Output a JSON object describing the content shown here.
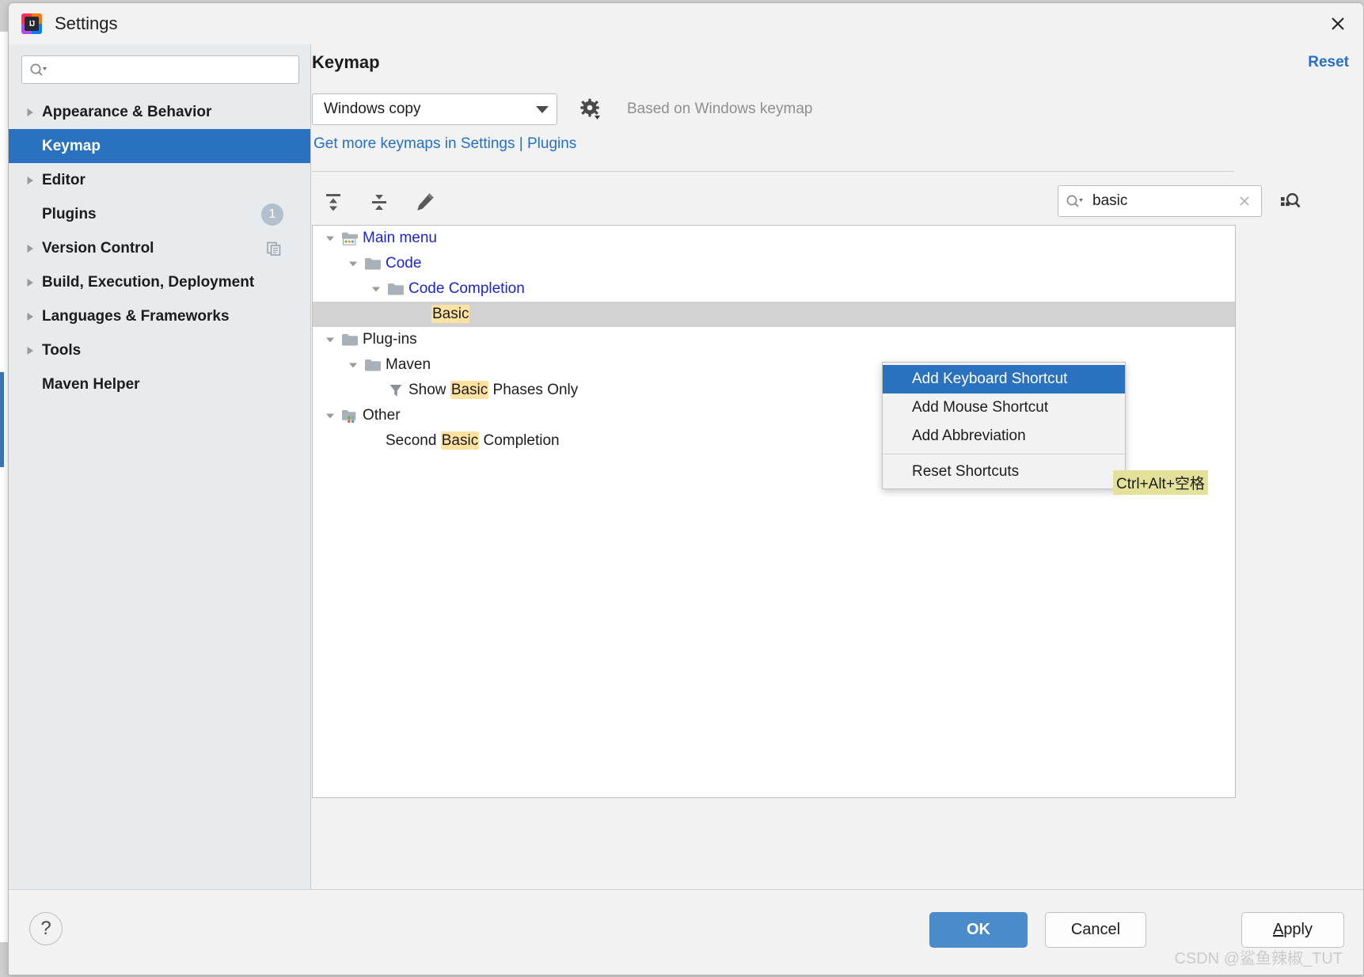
{
  "window": {
    "title": "Settings",
    "app_icon": "intellij-idea-logo",
    "close_icon": "close-icon"
  },
  "sidebar": {
    "search": {
      "value": "",
      "placeholder": "",
      "icon": "search-icon"
    },
    "items": [
      {
        "label": "Appearance & Behavior",
        "expandable": true,
        "selected": false,
        "badge": null,
        "trailing_icon": null
      },
      {
        "label": "Keymap",
        "expandable": false,
        "selected": true,
        "badge": null,
        "trailing_icon": null
      },
      {
        "label": "Editor",
        "expandable": true,
        "selected": false,
        "badge": null,
        "trailing_icon": null
      },
      {
        "label": "Plugins",
        "expandable": false,
        "selected": false,
        "badge": "1",
        "trailing_icon": null
      },
      {
        "label": "Version Control",
        "expandable": true,
        "selected": false,
        "badge": null,
        "trailing_icon": "copy-icon"
      },
      {
        "label": "Build, Execution, Deployment",
        "expandable": true,
        "selected": false,
        "badge": null,
        "trailing_icon": null
      },
      {
        "label": "Languages & Frameworks",
        "expandable": true,
        "selected": false,
        "badge": null,
        "trailing_icon": null
      },
      {
        "label": "Tools",
        "expandable": true,
        "selected": false,
        "badge": null,
        "trailing_icon": null
      },
      {
        "label": "Maven Helper",
        "expandable": false,
        "selected": false,
        "badge": null,
        "trailing_icon": null
      }
    ]
  },
  "main": {
    "title": "Keymap",
    "reset_label": "Reset",
    "keymap_select": {
      "value": "Windows copy",
      "icon": "chevron-down-icon"
    },
    "gear_icon": "gear-icon",
    "based_on": "Based on Windows keymap",
    "more_keymaps_link": "Get more keymaps in Settings | Plugins",
    "toolbar": [
      {
        "name": "expand-all-icon",
        "tooltip": "Expand All"
      },
      {
        "name": "collapse-all-icon",
        "tooltip": "Collapse All"
      },
      {
        "name": "edit-icon",
        "tooltip": "Edit Shortcut"
      }
    ],
    "shortcut_search": {
      "value": "basic",
      "placeholder": "",
      "search_icon": "search-icon",
      "clear_icon": "close-icon",
      "find_by_shortcut_icon": "find-by-shortcut-icon"
    }
  },
  "tree": [
    {
      "depth": 0,
      "label": "Main menu",
      "icon": "main-menu-icon",
      "expanded": true,
      "group": true,
      "selected": false,
      "highlight": null
    },
    {
      "depth": 1,
      "label": "Code",
      "icon": "folder-icon",
      "expanded": true,
      "group": true,
      "selected": false,
      "highlight": null
    },
    {
      "depth": 2,
      "label": "Code Completion",
      "icon": "folder-icon",
      "expanded": true,
      "group": true,
      "selected": false,
      "highlight": null
    },
    {
      "depth": 3,
      "label": "Basic",
      "icon": null,
      "expanded": null,
      "group": false,
      "selected": true,
      "highlight": "Basic"
    },
    {
      "depth": 0,
      "label": "Plug-ins",
      "icon": "folder-icon",
      "expanded": true,
      "group": false,
      "selected": false,
      "highlight": null
    },
    {
      "depth": 1,
      "label": "Maven",
      "icon": "folder-icon",
      "expanded": true,
      "group": false,
      "selected": false,
      "highlight": null
    },
    {
      "depth": 2,
      "label": "Show Basic Phases Only",
      "icon": "filter-icon",
      "expanded": null,
      "group": false,
      "selected": false,
      "highlight": "Basic"
    },
    {
      "depth": 0,
      "label": "Other",
      "icon": "other-folder-icon",
      "expanded": true,
      "group": false,
      "selected": false,
      "highlight": null
    },
    {
      "depth": 1,
      "label": "Second Basic Completion",
      "icon": null,
      "expanded": null,
      "group": false,
      "selected": false,
      "highlight": "Basic"
    }
  ],
  "shortcut_pill": "Ctrl+Alt+空格",
  "context_menu": [
    {
      "label": "Add Keyboard Shortcut",
      "active": true,
      "separator_before": false
    },
    {
      "label": "Add Mouse Shortcut",
      "active": false,
      "separator_before": false
    },
    {
      "label": "Add Abbreviation",
      "active": false,
      "separator_before": false
    },
    {
      "label": "Reset Shortcuts",
      "active": false,
      "separator_before": true
    }
  ],
  "footer": {
    "help_label": "?",
    "ok_label": "OK",
    "cancel_label": "Cancel",
    "apply_label_accel": "A",
    "apply_label_rest": "pply",
    "watermark": "CSDN @鲨鱼辣椒_TUT"
  },
  "colors": {
    "accent_blue": "#2a72c0",
    "link_blue": "#2470c9",
    "tree_group_blue": "#1b25d6",
    "highlight_yellow": "#ffe2a0",
    "shortcut_olive": "#e4e29a",
    "sidebar_bg": "#e7ebee",
    "panel_bg": "#f2f2f2",
    "selected_row_gray": "#d2d2d2"
  }
}
